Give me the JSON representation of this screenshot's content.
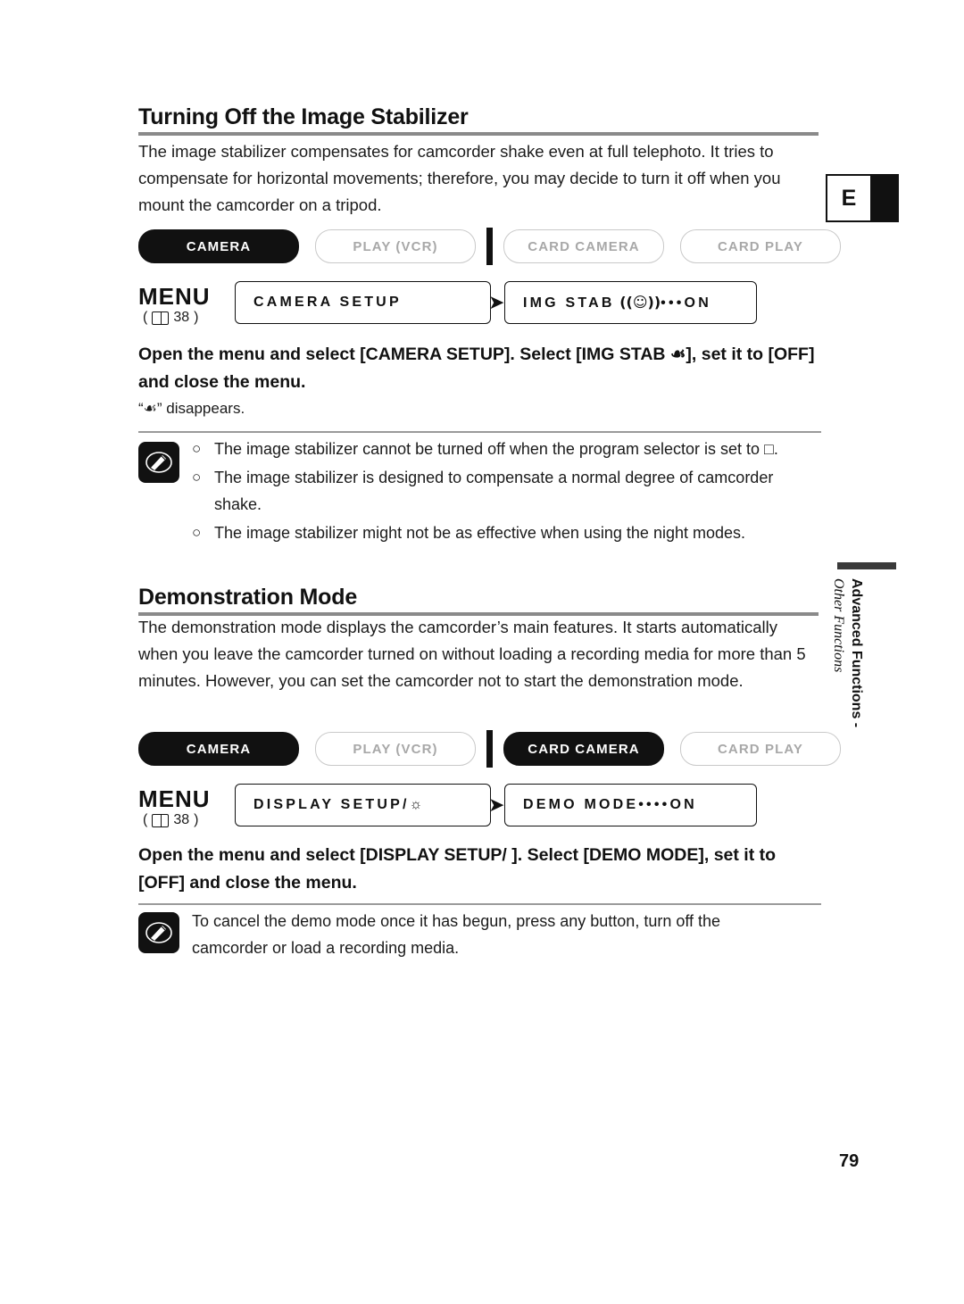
{
  "page": {
    "number": "79",
    "tab_letter": "E",
    "side_running_head_bold": "Advanced Functions -",
    "side_running_head_italic": "Other Functions"
  },
  "sections": [
    {
      "id": "image-stabilizer",
      "heading": "Turning Off the Image Stabilizer",
      "intro": "The image stabilizer compensates for camcorder shake even at full telephoto. It tries to compensate for horizontal movements; therefore, you may decide to turn it off when you mount the camcorder on a tripod.",
      "modes": [
        {
          "label": "CAMERA",
          "state": "on"
        },
        {
          "label": "PLAY (VCR)",
          "state": "off"
        },
        {
          "label": "CARD CAMERA",
          "state": "off"
        },
        {
          "label": "CARD PLAY",
          "state": "off"
        }
      ],
      "menu": {
        "label": "MENU",
        "page_ref": "38",
        "box_left": "CAMERA SETUP",
        "box_right": "IMG STAB ((☙))···ON",
        "box_right_prefix": "IMG  STAB",
        "box_right_suffix": "•••ON"
      },
      "instruction": "Open the menu and select [CAMERA SETUP]. Select [IMG STAB ☙], set it to [OFF] and close the menu.",
      "sub_note": "“☙” disappears.",
      "notes": [
        "The image stabilizer cannot be turned off when the program selector is set to □.",
        "The image stabilizer is designed to compensate a normal degree of camcorder shake.",
        "The image stabilizer might not be as effective when using the night modes."
      ]
    },
    {
      "id": "demonstration-mode",
      "heading": "Demonstration Mode",
      "intro": "The demonstration mode displays the camcorder’s main features. It starts automatically when you leave the camcorder turned on without loading a recording media for more than 5 minutes. However, you can set the camcorder not to start the demonstration mode.",
      "modes": [
        {
          "label": "CAMERA",
          "state": "on"
        },
        {
          "label": "PLAY (VCR)",
          "state": "off"
        },
        {
          "label": "CARD CAMERA",
          "state": "on"
        },
        {
          "label": "CARD PLAY",
          "state": "off"
        }
      ],
      "menu": {
        "label": "MENU",
        "page_ref": "38",
        "box_left": "DISPLAY SETUP/",
        "box_right_prefix": "DEMO  MODE",
        "box_right_suffix": "••••ON"
      },
      "instruction": "Open the menu and select [DISPLAY SETUP/ ]. Select [DEMO MODE], set it to [OFF] and close the menu.",
      "notes": [
        "To cancel the demo mode once it has begun, press any button, turn off the camcorder or load a recording media."
      ]
    }
  ]
}
